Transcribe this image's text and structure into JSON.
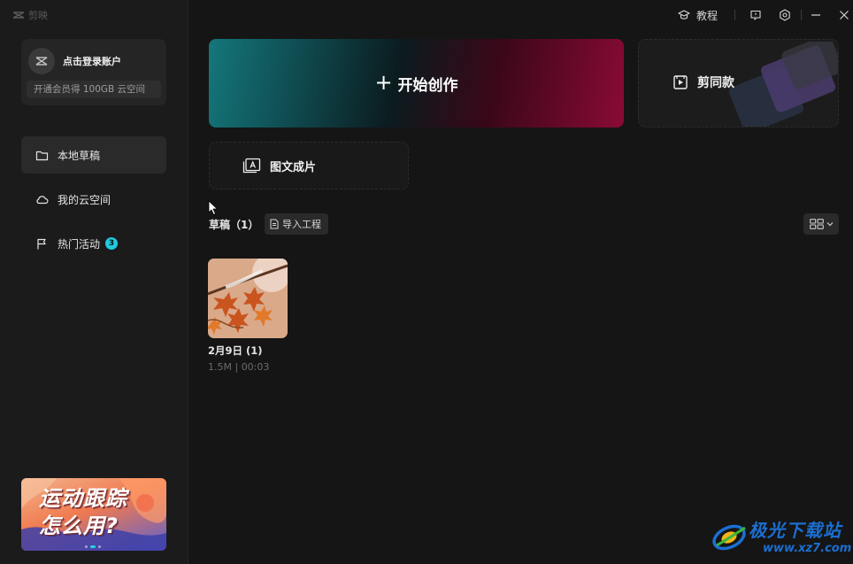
{
  "app": {
    "name": "剪映"
  },
  "sidebar": {
    "account": {
      "login_label": "点击登录账户",
      "vip_promo": "开通会员得 100GB 云空间"
    },
    "items": [
      {
        "label": "本地草稿",
        "icon": "folder-icon",
        "active": true
      },
      {
        "label": "我的云空间",
        "icon": "cloud-icon",
        "active": false
      },
      {
        "label": "热门活动",
        "icon": "flag-icon",
        "active": false,
        "badge": "3"
      }
    ],
    "banner": {
      "line1": "运动跟踪",
      "line2": "怎么用?"
    }
  },
  "topbar": {
    "tutorial_label": "教程",
    "icons": [
      "graduation-cap-icon",
      "feedback-icon",
      "settings-icon",
      "minimize-icon",
      "close-icon"
    ]
  },
  "main": {
    "create_label": "开始创作",
    "template_label": "剪同款",
    "image_text_label": "图文成片",
    "drafts": {
      "title": "草稿",
      "count": "（1）",
      "import_label": "导入工程",
      "items": [
        {
          "name": "2月9日 (1)",
          "size": "1.5M",
          "duration": "00:03"
        }
      ]
    }
  },
  "watermark": {
    "site_name": "极光下载站",
    "url": "www.xz7.com"
  },
  "colors": {
    "background": "#151515",
    "sidebar": "#1b1b1b",
    "badge": "#1ecbe0",
    "create_gradient_start": "#14777a",
    "create_gradient_end": "#8a0a36"
  }
}
